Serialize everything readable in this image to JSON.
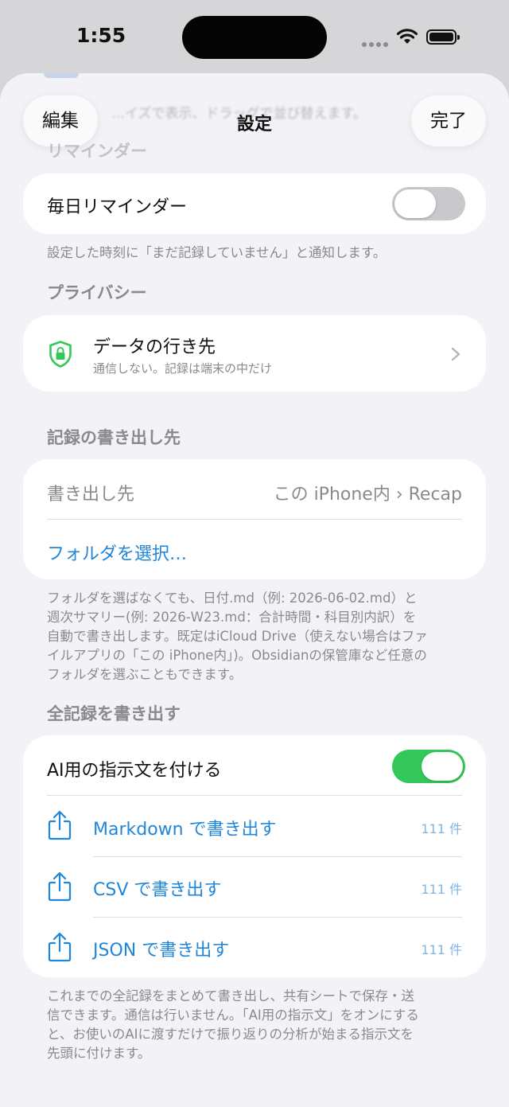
{
  "status": {
    "time": "1:55"
  },
  "background": {
    "scrolled_text": "…イズで表示、ドラッグで並び替えます。"
  },
  "nav": {
    "edit": "編集",
    "title": "設定",
    "done": "完了"
  },
  "reminder": {
    "header": "リマインダー",
    "daily_label": "毎日リマインダー",
    "daily_on": false,
    "footer": "設定した時刻に「まだ記録していません」と通知します。"
  },
  "privacy": {
    "header": "プライバシー",
    "title": "データの行き先",
    "subtitle": "通信しない。記録は端末の中だけ"
  },
  "export_dest": {
    "header": "記録の書き出し先",
    "label": "書き出し先",
    "value": "この iPhone内 › Recap",
    "choose_folder": "フォルダを選択…",
    "footer": [
      "フォルダを選ばなくても、日付.md（例: 2026-06-02.md）と",
      "週次サマリー(例: 2026-W23.md：合計時間・科目別内訳）を",
      "自動で書き出します。既定はiCloud Drive（使えない場合はファ",
      "イルアプリの「この iPhone内」)。Obsidianの保管庫など任意の",
      "フォルダを選ぶこともできます。"
    ]
  },
  "export_all": {
    "header": "全記録を書き出す",
    "ai_label": "AI用の指示文を付ける",
    "ai_on": true,
    "items": [
      {
        "label": "Markdown で書き出す",
        "count": "111 件",
        "icon": "share-icon"
      },
      {
        "label": "CSV で書き出す",
        "count": "111 件",
        "icon": "share-icon"
      },
      {
        "label": "JSON で書き出す",
        "count": "111 件",
        "icon": "share-icon"
      }
    ],
    "footer": [
      "これまでの全記録をまとめて書き出し、共有シートで保存・送",
      "信できます。通信は行いません。「AI用の指示文」をオンにする",
      "と、お使いのAIに渡すだけで振り返りの分析が始まる指示文を",
      "先頭に付けます。"
    ]
  },
  "colors": {
    "accent": "#1f86d9",
    "toggle_on": "#34c759",
    "toggle_off": "#c9c9cd",
    "shield": "#34c759"
  }
}
